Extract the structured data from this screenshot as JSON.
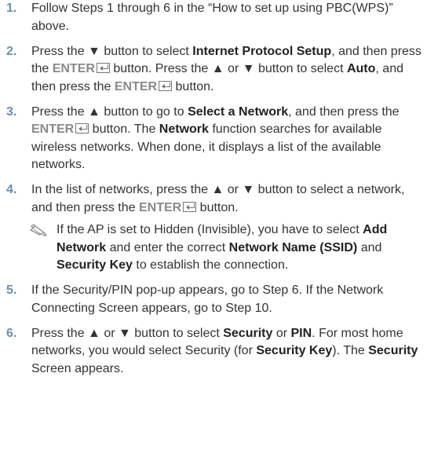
{
  "steps": [
    {
      "number": "1.",
      "parts": [
        "Follow Steps 1 through 6 in the “How to set up using PBC(WPS)” above."
      ]
    },
    {
      "number": "2.",
      "parts": [
        "Press the ▼ button to select ",
        "Internet Protocol Setup",
        ", and then press the ",
        "ENTER",
        " button. Press the ▲ or ▼ button to select ",
        "Auto",
        ", and then press the ",
        "ENTER",
        " button."
      ]
    },
    {
      "number": "3.",
      "parts": [
        "Press the ▲ button to go to ",
        "Select a Network",
        ", and then press the ",
        "ENTER",
        " button. The ",
        "Network",
        " function searches for available wireless networks. When done, it displays a list of the available networks."
      ]
    },
    {
      "number": "4.",
      "parts": [
        "In the list of networks, press the ▲ or ▼ button to select a network, and then press the ",
        "ENTER",
        " button."
      ],
      "note": {
        "icon": "pencil-note-icon",
        "parts": [
          "If the AP is set to Hidden (Invisible), you have to select ",
          "Add Network",
          " and enter the correct ",
          "Network Name (SSID)",
          " and ",
          "Security Key",
          " to establish the connection."
        ]
      }
    },
    {
      "number": "5.",
      "parts": [
        "If the Security/PIN pop-up appears, go to Step 6. If the Network Connecting Screen appears, go to Step 10."
      ]
    },
    {
      "number": "6.",
      "parts": [
        "Press the ▲ or ▼ button to select ",
        "Security",
        " or ",
        "PIN",
        ". For most home networks, you would select Security (for ",
        "Security Key",
        "). The ",
        "Security",
        " Screen appears."
      ]
    }
  ]
}
